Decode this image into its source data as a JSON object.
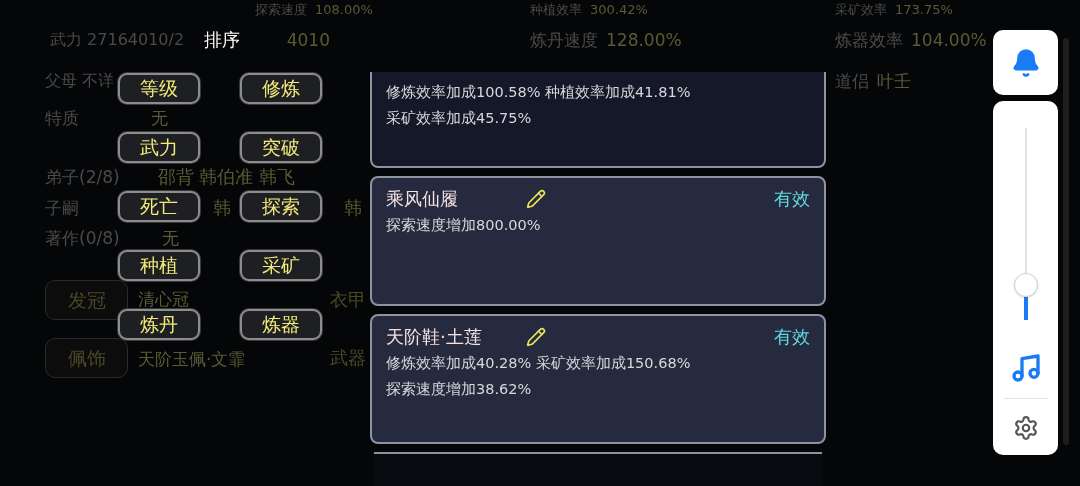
{
  "background": {
    "top_stats": [
      {
        "label": "探索速度",
        "value": "108.00%"
      },
      {
        "label": "种植效率",
        "value": "300.42%"
      },
      {
        "label": "采矿效率",
        "value": "173.75%"
      }
    ],
    "power_fragments": [
      "武力 27164010/2",
      "4010"
    ],
    "mid_stats": [
      {
        "label": "炼丹速度",
        "value": "128.00%"
      },
      {
        "label": "炼器效率",
        "value": "104.00%"
      }
    ],
    "parents": "父母 不详",
    "partner": {
      "label": "道侣",
      "value": "叶壬"
    },
    "trait": {
      "label": "特质",
      "value": "无"
    },
    "disciples": {
      "label": "弟子(2/8)",
      "value": "邵背 韩伯准 韩飞"
    },
    "children": {
      "label": "子嗣",
      "fragments": [
        "韩",
        "韩"
      ]
    },
    "works": {
      "label": "著作(0/8)",
      "value": "无"
    },
    "equipment": [
      {
        "slot": "发冠",
        "item": "清心冠",
        "slot_2": "衣甲"
      },
      {
        "slot": "佩饰",
        "item": "天阶玉佩·文霏",
        "slot_2": "武器"
      }
    ]
  },
  "sort_dialog": {
    "title": "排序",
    "options": [
      "等级",
      "修炼",
      "武力",
      "突破",
      "死亡",
      "探索",
      "种植",
      "采矿",
      "炼丹",
      "炼器"
    ]
  },
  "cards": [
    {
      "lines": [
        "修炼效率加成100.58% 种植效率加成41.81%",
        "采矿效率加成45.75%"
      ]
    },
    {
      "name": "乘风仙履",
      "status": "有效",
      "lines": [
        "探索速度增加800.00%"
      ]
    },
    {
      "name": "天阶鞋·土莲",
      "status": "有效",
      "lines": [
        "修炼效率加成40.28% 采矿效率加成150.68%",
        "探索速度增加38.62%"
      ]
    }
  ],
  "volume": {
    "level": 0.12
  }
}
